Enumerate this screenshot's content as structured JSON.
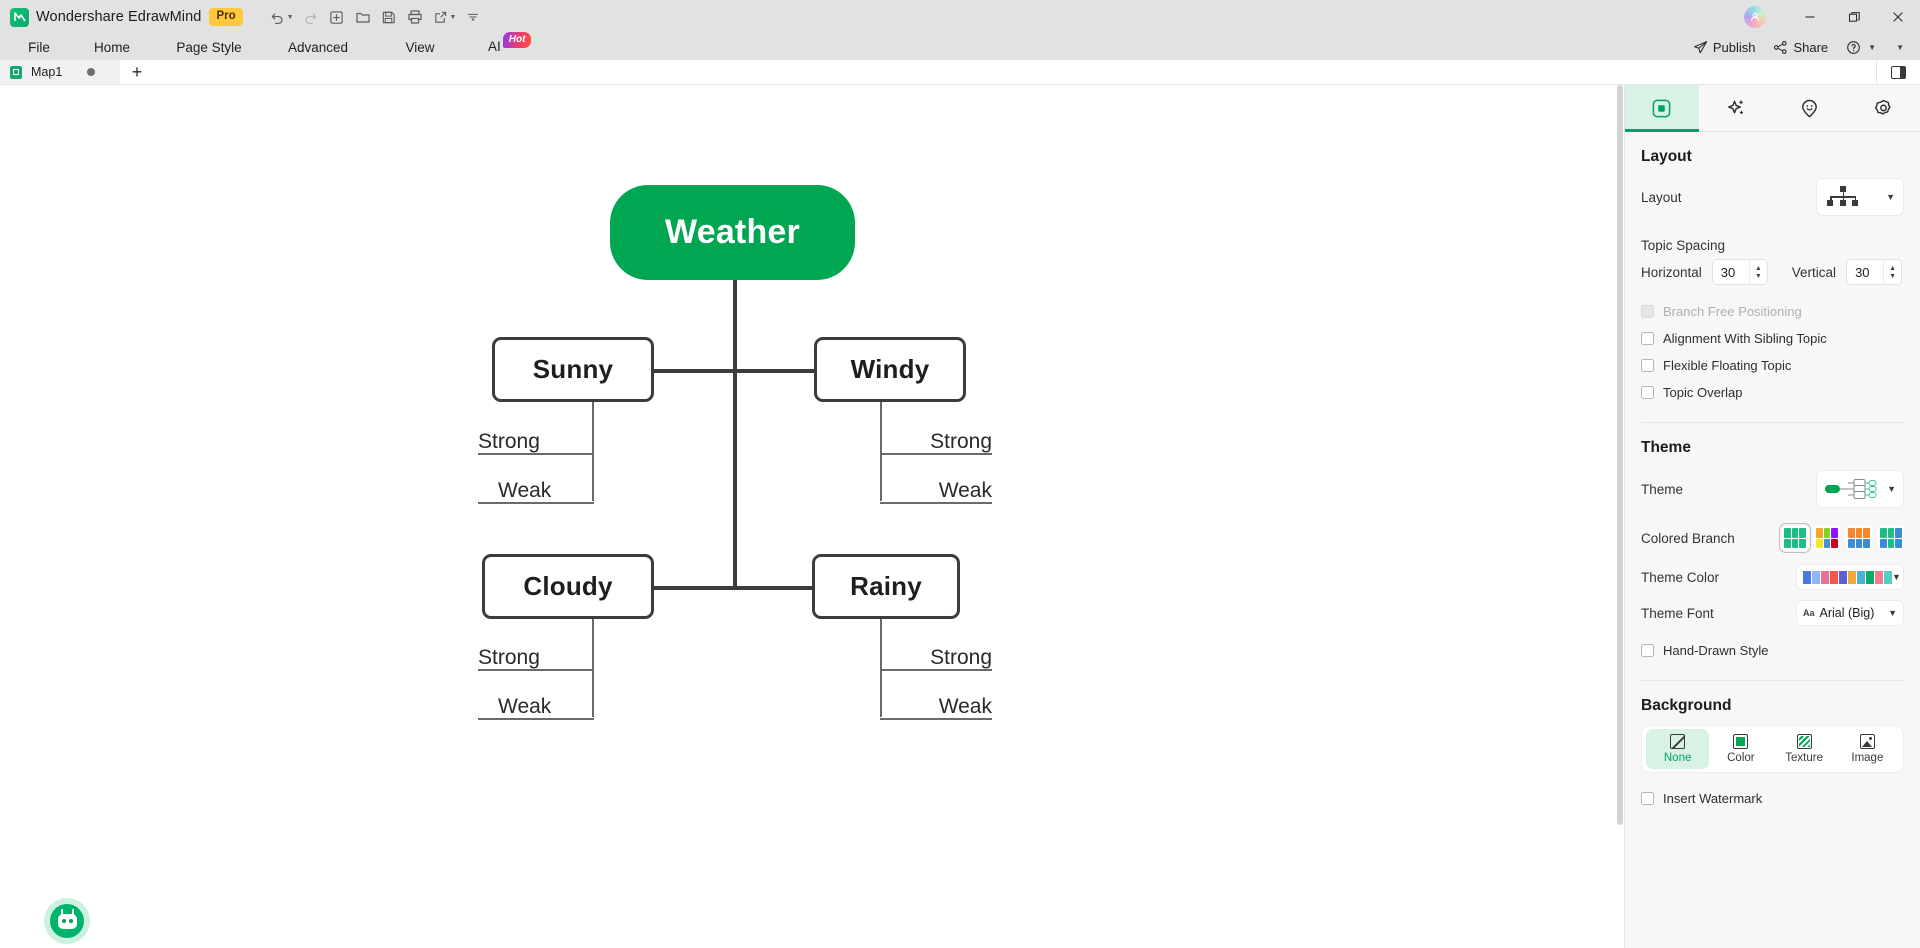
{
  "titlebar": {
    "app_title": "Wondershare EdrawMind",
    "pro_badge": "Pro",
    "logo_icon": "edrawmind-logo-icon",
    "icons": [
      {
        "name": "undo-icon",
        "glyph": "↶"
      },
      {
        "name": "redo-icon",
        "glyph": "↷"
      },
      {
        "name": "new-icon",
        "glyph": "+"
      },
      {
        "name": "open-folder-icon",
        "glyph": "⬚"
      },
      {
        "name": "save-icon",
        "glyph": "⬚"
      },
      {
        "name": "print-icon",
        "glyph": "⎙"
      },
      {
        "name": "export-share-icon",
        "glyph": "↗"
      },
      {
        "name": "more-toolbar-icon",
        "glyph": "≡"
      }
    ],
    "avatar": "user-avatar",
    "minimize": "—",
    "maximize": "❐",
    "close": "✕"
  },
  "menubar": {
    "items": [
      {
        "label": "File",
        "name": "menu-file"
      },
      {
        "label": "Home",
        "name": "menu-home"
      },
      {
        "label": "Page Style",
        "name": "menu-page-style"
      },
      {
        "label": "Advanced",
        "name": "menu-advanced"
      },
      {
        "label": "View",
        "name": "menu-view"
      }
    ],
    "ai_label": "AI",
    "ai_badge": "Hot",
    "publish_label": "Publish",
    "share_label": "Share",
    "help_label": "?"
  },
  "tabstrip": {
    "doc_tab": "Map1",
    "add_tab": "+"
  },
  "panel": {
    "tabs": [
      {
        "name": "tab-layout",
        "icon": "frame-icon",
        "active": true
      },
      {
        "name": "tab-style",
        "icon": "sparkle-icon",
        "active": false
      },
      {
        "name": "tab-clipart",
        "icon": "smiley-pin-icon",
        "active": false
      },
      {
        "name": "tab-settings",
        "icon": "gear-icon",
        "active": false
      }
    ],
    "layout": {
      "title": "Layout",
      "layout_label": "Layout",
      "layout_value_icon": "org-chart-layout-icon",
      "topic_spacing_label": "Topic Spacing",
      "horizontal_label": "Horizontal",
      "horizontal_value": "30",
      "vertical_label": "Vertical",
      "vertical_value": "30",
      "checkboxes": [
        {
          "label": "Branch Free Positioning",
          "checked": false,
          "disabled": true,
          "name": "checkbox-branch-free-positioning"
        },
        {
          "label": "Alignment With Sibling Topic",
          "checked": false,
          "disabled": false,
          "name": "checkbox-alignment-with-sibling-topic"
        },
        {
          "label": "Flexible Floating Topic",
          "checked": false,
          "disabled": false,
          "name": "checkbox-flexible-floating-topic"
        },
        {
          "label": "Topic Overlap",
          "checked": false,
          "disabled": false,
          "name": "checkbox-topic-overlap"
        }
      ]
    },
    "theme": {
      "title": "Theme",
      "theme_label": "Theme",
      "colored_branch_label": "Colored Branch",
      "colored_branch_sets": [
        {
          "name": "branch-set-green",
          "selected": true,
          "colors": [
            "#1bbf84",
            "#1bbf84",
            "#1bbf84",
            "#1bbf84",
            "#1bbf84",
            "#1bbf84"
          ]
        },
        {
          "name": "branch-set-multicolor",
          "selected": false,
          "colors": [
            "#f5a623",
            "#7ed321",
            "#9013fe",
            "#f8e71c",
            "#4a90d9",
            "#d0021b"
          ]
        },
        {
          "name": "branch-set-orange-blue",
          "selected": false,
          "colors": [
            "#f5862a",
            "#f5862a",
            "#f5862a",
            "#3d8bd4",
            "#3d8bd4",
            "#3d8bd4"
          ]
        },
        {
          "name": "branch-set-teal-blue",
          "selected": false,
          "colors": [
            "#1bbf84",
            "#1bbf84",
            "#3d8bd4",
            "#3d8bd4",
            "#1bbf84",
            "#3d8bd4"
          ]
        }
      ],
      "theme_color_label": "Theme Color",
      "theme_color_swatches": [
        "#4a76e8",
        "#8fb7f5",
        "#e8709a",
        "#f0564b",
        "#5a5fd4",
        "#f2a93b",
        "#4bb3d4",
        "#0cab63",
        "#f57a8e",
        "#55cfbd"
      ],
      "theme_font_label": "Theme Font",
      "theme_font_value": "Arial (Big)",
      "hand_drawn_label": "Hand-Drawn Style",
      "hand_drawn_checked": false
    },
    "background": {
      "title": "Background",
      "options": [
        {
          "label": "None",
          "name": "bg-option-none",
          "active": true
        },
        {
          "label": "Color",
          "name": "bg-option-color",
          "active": false
        },
        {
          "label": "Texture",
          "name": "bg-option-texture",
          "active": false
        },
        {
          "label": "Image",
          "name": "bg-option-image",
          "active": false
        }
      ],
      "insert_watermark_label": "Insert Watermark",
      "insert_watermark_checked": false
    }
  },
  "mindmap": {
    "central": {
      "text": "Weather",
      "color": "#00a651",
      "text_color": "#ffffff"
    },
    "branches": [
      {
        "text": "Sunny",
        "side": "left",
        "children": [
          "Strong",
          "Weak"
        ]
      },
      {
        "text": "Windy",
        "side": "right",
        "children": [
          "Strong",
          "Weak"
        ]
      },
      {
        "text": "Cloudy",
        "side": "left",
        "children": [
          "Strong",
          "Weak"
        ]
      },
      {
        "text": "Rainy",
        "side": "right",
        "children": [
          "Strong",
          "Weak"
        ]
      }
    ],
    "node_border_color": "#3c3c3c"
  },
  "assistant": {
    "name": "ai-assistant-button",
    "icon": "robot-icon"
  }
}
